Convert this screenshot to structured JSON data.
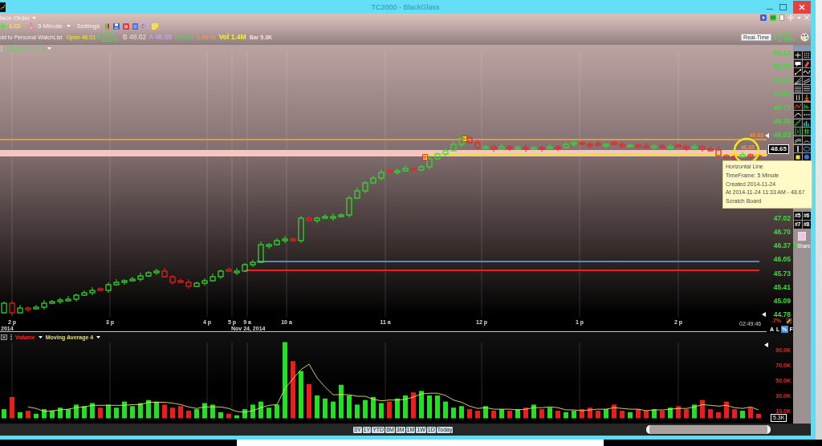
{
  "window": {
    "title": "TC2000 - BlackGlass"
  },
  "order_menu": {
    "label": "lace Order"
  },
  "toolbar": {
    "symbol": "LCI",
    "timeframe": "5 Minute",
    "settings": "Settings"
  },
  "quote": {
    "watchlist_link": "dd to Personal WatchList",
    "open": "Open 46.01",
    "change": "3.13",
    "change_percent": "6.81%",
    "bid": "B 48.62",
    "ask": "A 48.66",
    "high": "H 49.07",
    "low": "L 45.00",
    "volume": "Vol 1.4M",
    "bar_volume": "Bar 5.3K"
  },
  "realtime": {
    "label": "Real-Time",
    "change": "3.13",
    "change_percent": "6.85%"
  },
  "chart": {
    "title": "LCI Lannett Co",
    "price_ticks_upper": [
      "51.14",
      "50.78",
      "50.43",
      "50.07",
      "49.72",
      "49.38",
      "49.03"
    ],
    "price_ticks_lower": [
      "47.02",
      "46.70",
      "46.37",
      "46.05",
      "45.73",
      "45.41",
      "45.09",
      "44.78"
    ],
    "last_price": "48.65",
    "line_labels": [
      "49.03",
      "48.65"
    ],
    "lines": [
      {
        "color": "#f0923a"
      },
      {
        "color": "#f6c6c0"
      },
      {
        "color": "#ecdc3c"
      },
      {
        "color": "#4a8ad8"
      },
      {
        "color": "#e02424"
      }
    ],
    "time_labels": [
      "2 p",
      "3 p",
      "4 p",
      "5 p",
      "9 a",
      "10 a",
      "11 a",
      "12 p",
      "1 p",
      "2 p"
    ],
    "date_labels": [
      "2014",
      "Nov 24, 2014"
    ],
    "clock": "02:49:46",
    "percent_change": ".7%",
    "scale_modes": [
      {
        "label": "A",
        "selected": false
      },
      {
        "label": "L",
        "selected": false
      },
      {
        "label": "%",
        "selected": true
      },
      {
        "label": "F",
        "selected": false
      }
    ],
    "tooltip": [
      "Horizontal Line",
      "TimeFrame: 5 Minute",
      "Created 2014-11-24",
      "At 2014-11-24 11:33 AM - 48.67",
      "Scratch Board"
    ]
  },
  "volume": {
    "chart_data": {
      "type": "bar",
      "title": "Volume",
      "ylim": [
        0,
        100
      ],
      "yticks": [
        {
          "value": 90,
          "label": "90.0K"
        },
        {
          "value": 70,
          "label": "70.0K"
        },
        {
          "value": 50,
          "label": "50.0K"
        },
        {
          "value": 30,
          "label": "30.0K"
        },
        {
          "value": 10,
          "label": "10.0K"
        }
      ],
      "series": [
        {
          "color": "#22e022",
          "values": [
            12,
            null,
            8,
            null,
            6,
            12,
            10,
            14,
            12,
            18,
            16,
            20,
            null,
            18,
            14,
            22,
            16,
            20,
            24,
            22,
            null,
            null,
            null,
            null,
            12,
            20,
            18,
            8,
            null,
            4,
            12,
            18,
            22,
            14,
            18,
            100,
            null,
            62,
            null,
            30,
            26,
            22,
            44,
            30,
            18,
            24,
            28,
            20,
            null,
            26,
            30,
            null,
            36,
            30,
            30,
            22,
            14,
            16,
            null,
            null,
            16,
            null,
            12,
            null,
            12,
            null,
            18,
            null,
            14,
            null,
            8,
            10,
            null,
            null,
            null,
            12,
            null,
            null,
            8,
            null,
            null,
            12,
            null,
            14,
            null,
            null,
            18,
            null,
            null,
            null,
            null,
            null,
            10,
            null,
            null
          ]
        },
        {
          "color": "#ee1c1c",
          "values": [
            null,
            28,
            null,
            10,
            null,
            null,
            null,
            null,
            null,
            null,
            null,
            null,
            14,
            null,
            null,
            null,
            null,
            null,
            null,
            null,
            18,
            14,
            16,
            10,
            null,
            null,
            null,
            null,
            6,
            null,
            null,
            null,
            null,
            null,
            null,
            null,
            75,
            null,
            45,
            null,
            null,
            null,
            null,
            null,
            null,
            null,
            null,
            null,
            22,
            null,
            null,
            34,
            null,
            null,
            null,
            null,
            null,
            null,
            12,
            10,
            null,
            10,
            null,
            10,
            null,
            14,
            null,
            12,
            null,
            10,
            null,
            null,
            12,
            14,
            10,
            null,
            18,
            10,
            null,
            12,
            10,
            null,
            10,
            null,
            16,
            12,
            null,
            24,
            12,
            8,
            22,
            12,
            null,
            14,
            6
          ]
        },
        {
          "name": "Moving Average 4",
          "type": "line",
          "color": "#e8e070",
          "values": [
            null,
            null,
            null,
            15,
            13,
            9,
            10,
            11,
            12,
            14,
            15,
            17,
            17,
            17,
            17,
            17,
            18,
            18,
            21,
            21,
            21,
            20,
            18,
            15,
            13,
            15,
            15,
            15,
            13,
            9,
            8,
            10,
            14,
            17,
            18,
            39,
            52,
            64,
            71,
            53,
            41,
            31,
            31,
            31,
            29,
            29,
            25,
            23,
            24,
            24,
            25,
            28,
            32,
            33,
            33,
            30,
            24,
            21,
            16,
            13,
            14,
            12,
            12,
            12,
            11,
            12,
            14,
            14,
            15,
            14,
            11,
            11,
            10,
            11,
            12,
            12,
            14,
            13,
            12,
            12,
            10,
            11,
            11,
            12,
            13,
            13,
            15,
            18,
            17,
            16,
            17,
            14,
            13,
            15,
            11
          ]
        }
      ]
    },
    "last_volume": "5.3K"
  },
  "ranges": [
    "3Y",
    "1Y",
    "YTD",
    "6M",
    "3M",
    "1M",
    "1W",
    "1D",
    "Today"
  ],
  "layouts": [
    "#5",
    "#6",
    "#7",
    "#8"
  ],
  "share": {
    "label": "Share"
  }
}
